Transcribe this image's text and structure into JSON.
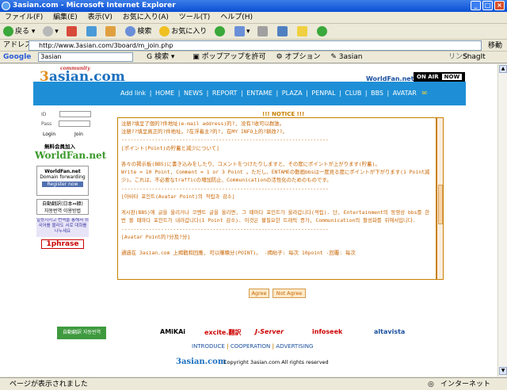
{
  "window": {
    "title": "3asian.com - Microsoft Internet Explorer"
  },
  "menu": [
    "ファイル(F)",
    "編集(E)",
    "表示(V)",
    "お気に入り(A)",
    "ツール(T)",
    "ヘルプ(H)"
  ],
  "toolbar": {
    "back": "戻る",
    "search": "検索",
    "favorites": "お気に入り"
  },
  "address": {
    "label": "アドレス(D)",
    "url": "http://www.3asian.com/3board/m_join.php",
    "go": "移動"
  },
  "google": {
    "label": "Google",
    "search_value": "3asian",
    "search_btn": "検索",
    "popup": "ポップアップを許可",
    "options": "オプション",
    "tab": "3asian",
    "link": "リンク",
    "snagit": "SnagIt"
  },
  "site": {
    "logo_sub": "community",
    "logo_num": "3",
    "logo_text": "asian.com",
    "worldfan": "WorldFan.net",
    "onair": "ON AIR",
    "now": "NOW",
    "nav": [
      "Add link",
      "HOME",
      "NEWS",
      "REPORT",
      "ENTAME",
      "PLAZA",
      "PENPAL",
      "CLUB",
      "BBS",
      "AVATAR"
    ],
    "login": {
      "id_label": "ID",
      "pw_label": "Pass",
      "login": "Login",
      "join": "Join"
    },
    "free_member": "無料会員加入",
    "worldfan_logo": "WorldFan.net",
    "worldfan_box": "WorldFan.net",
    "worldfan_sub": "Domain forwarding",
    "register": "Register now",
    "auto_trans": "自動翻訳(日本⇔韓)",
    "auto_trans_kr": "자동번역 이용방법",
    "ad_text": "일등시키고 번역을 통해서 외국어를 몰라도 서로 대화를 나누세요",
    "phrase": "1phrase",
    "notice_title": "!!! NOTICE !!!",
    "notice_lines": [
      "注册?填呈了個的?件地址(e-mail address)的?, 没有?收可以群誰。",
      "注册??填呈真正的?件地址。?在浮着主?的?, 在MY INFO上的?耕改??。",
      "--------------------------------------------------------------------",
      "[ポイント(Point)の貯蓄と減少について]",
      "",
      "各々の掲示板(BBS)に書き込みをしたり、コメントをつけたりしますと、その度にポイントが上がります(貯蓄)。",
      "Write = 10 Point, Comment = 1 or 3 Point 。ただし、ENTAMEの動画bbsは一度見る度にポイントが下がります(1 Point減少)。これは、不必要なtrafficの増加防止、Communicationの活性化のためのものです。",
      "--------------------------------------------------------------------",
      "[아바타 포인트(Avatar Point)의 적립과 감소]",
      "",
      "게시판(BBS)에 글을 올리거나 코멘트 글을 올리면, 그 때마다 포인트가 올라갑니다(적립). 단, Entertainment의 동영상 bbs를 한번 볼 때마다 포인트가 내려갑니다(1 Point 감소). 이것은 불필요한 트래픽 증가, Communication의 활성화를 위해서입니다.",
      "--------------------------------------------------------------------",
      "[Avatar Point的?分及?分]",
      "",
      "通過在 3asian.com 上揭戳和回應, 可以賺積分(POINT)。 -揭貼子: 每次 10point       -回覆: 每次"
    ],
    "agree": "Agree",
    "not_agree": "Not Agree",
    "partners": {
      "auto": "自動翻訳 자동번역",
      "amikai": "AMiKAi",
      "excite": "excite.翻訳",
      "jserver": "J-Server",
      "infoseek": "infoseek",
      "altavista": "altavista"
    },
    "footer_links": [
      "INTRODUCE",
      "COOPERATION",
      "ADVERTISING"
    ],
    "footer_logo": "3asian.com",
    "copyright": "Copyright 3asian.com  All rights reserved"
  },
  "status": {
    "text": "ページが表示されました",
    "zone": "インターネット"
  }
}
